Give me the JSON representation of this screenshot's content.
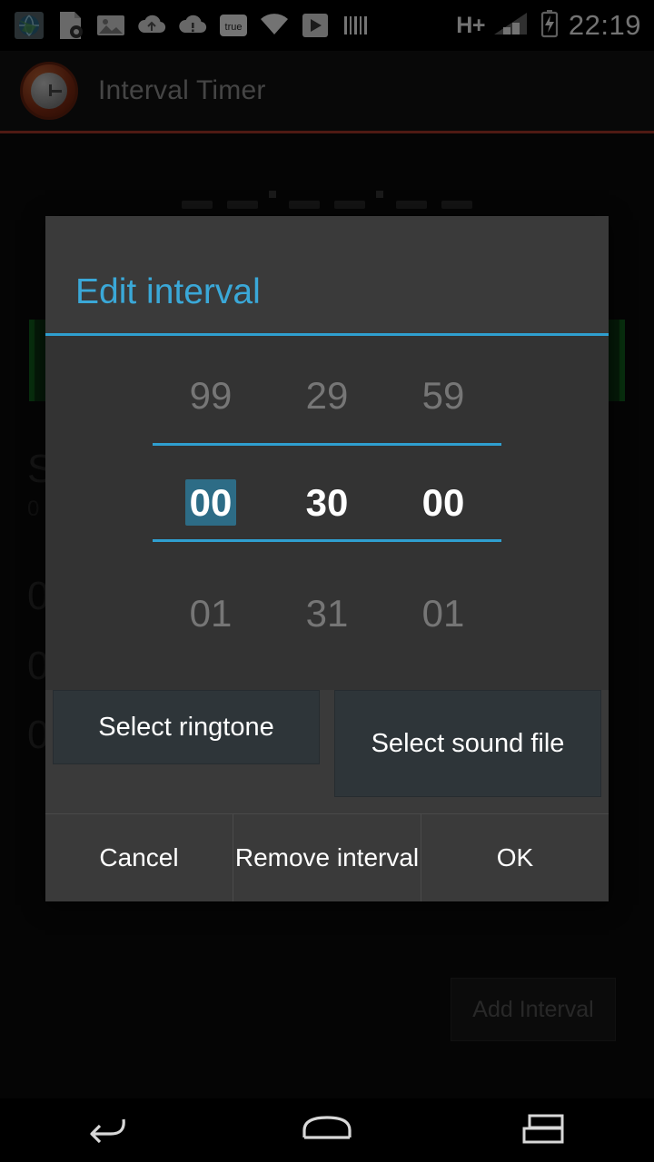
{
  "status_bar": {
    "icons": [
      "globe-app-icon",
      "document-settings-icon",
      "image-icon",
      "cloud-upload-icon",
      "cloud-alert-icon",
      "true-badge-icon",
      "wifi-icon",
      "play-store-icon",
      "barcode-icon"
    ],
    "true_badge_label": "true",
    "network_type": "H+",
    "signal_icon": "signal-bars-icon",
    "battery_icon": "battery-charging-icon",
    "clock": "22:19"
  },
  "app_bar": {
    "icon": "interval-timer-app-icon",
    "title": "Interval Timer"
  },
  "background": {
    "add_interval_label": "Add Interval",
    "rows": [
      {
        "title": "S",
        "subtitle": "0"
      },
      {
        "title": "0"
      },
      {
        "title": "0"
      },
      {
        "title": "0"
      }
    ]
  },
  "dialog": {
    "title": "Edit interval",
    "picker": {
      "columns": [
        {
          "name": "hours",
          "previous": "99",
          "value": "00",
          "next": "01",
          "selected": true
        },
        {
          "name": "minutes",
          "previous": "29",
          "value": "30",
          "next": "31",
          "selected": false
        },
        {
          "name": "seconds",
          "previous": "59",
          "value": "00",
          "next": "01",
          "selected": false
        }
      ]
    },
    "buttons": {
      "select_ringtone": "Select ringtone",
      "select_sound_file": "Select sound file"
    },
    "actions": {
      "cancel": "Cancel",
      "remove": "Remove interval",
      "ok": "OK"
    }
  },
  "nav_bar": {
    "back": "back-icon",
    "home": "home-icon",
    "recents": "recents-icon"
  },
  "colors": {
    "accent": "#2f9fd0",
    "title": "#3aa8d8",
    "selection": "#2d6c86",
    "dialog_bg": "#3a3a3a",
    "appbar_rule": "#b03a2b"
  }
}
